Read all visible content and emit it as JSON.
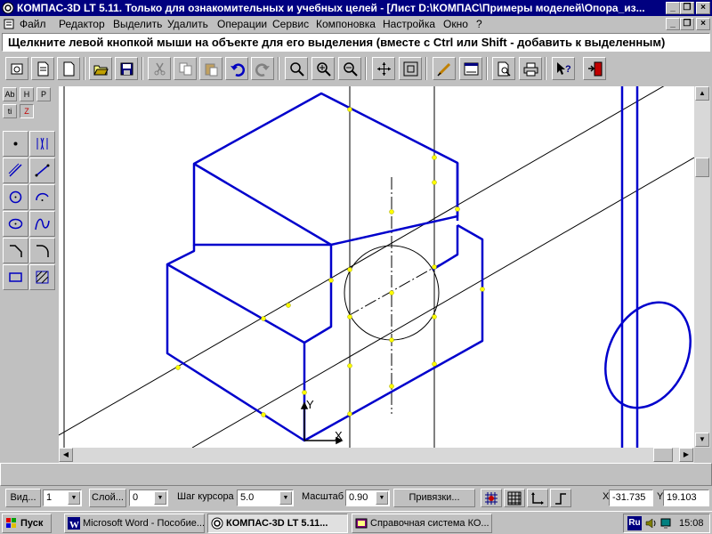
{
  "window": {
    "title": "КОМПАС-3D LT 5.11. Только для ознакомительных и учебных целей - [Лист D:\\КОМПАС\\Примеры моделей\\Опора_из..."
  },
  "menubar": {
    "items": [
      "Файл",
      "Редактор",
      "Выделить",
      "Удалить",
      "Операции",
      "Сервис",
      "Компоновка",
      "Настройка",
      "Окно",
      "?"
    ]
  },
  "hint": "Щелкните левой кнопкой мыши на объекте для его выделения (вместе с Ctrl или Shift - добавить к выделенным)",
  "toolbar": {
    "buttons": [
      "new-3d",
      "new-doc",
      "new-blank",
      "open",
      "save",
      "cut",
      "copy",
      "paste",
      "undo",
      "redo",
      "zoom",
      "zoom-in",
      "zoom-out",
      "pan",
      "fit-all",
      "refresh",
      "properties",
      "preview",
      "print",
      "help",
      "exit"
    ]
  },
  "leftpanel": {
    "tabs": [
      "Ab",
      "H",
      "P",
      "ti",
      "Z"
    ],
    "tools": [
      "point",
      "aux-line",
      "segment",
      "segment-2",
      "circle",
      "arc",
      "ellipse",
      "curve",
      "chamfer",
      "fillet",
      "rectangle",
      "hatch"
    ]
  },
  "status": {
    "view_label": "Вид",
    "view_value": "1",
    "layer_label": "Слой",
    "layer_value": "0",
    "step_label": "Шаг курсора",
    "step_value": "5.0",
    "scale_label": "Масштаб",
    "scale_value": "0.90",
    "snaps_label": "Привязки",
    "x_label": "X",
    "x_value": "-31.735",
    "y_label": "Y",
    "y_value": "19.103"
  },
  "canvas": {
    "axis_y": "Y",
    "axis_x": "X",
    "colors": {
      "model": "#0000cc",
      "aux": "#000000",
      "point": "#ffff00"
    }
  },
  "taskbar": {
    "start": "Пуск",
    "tasks": [
      "Microsoft Word - Пособие...",
      "КОМПАС-3D LT 5.11...",
      "Справочная система КО..."
    ],
    "lang": "Ru",
    "clock": "15:08"
  }
}
